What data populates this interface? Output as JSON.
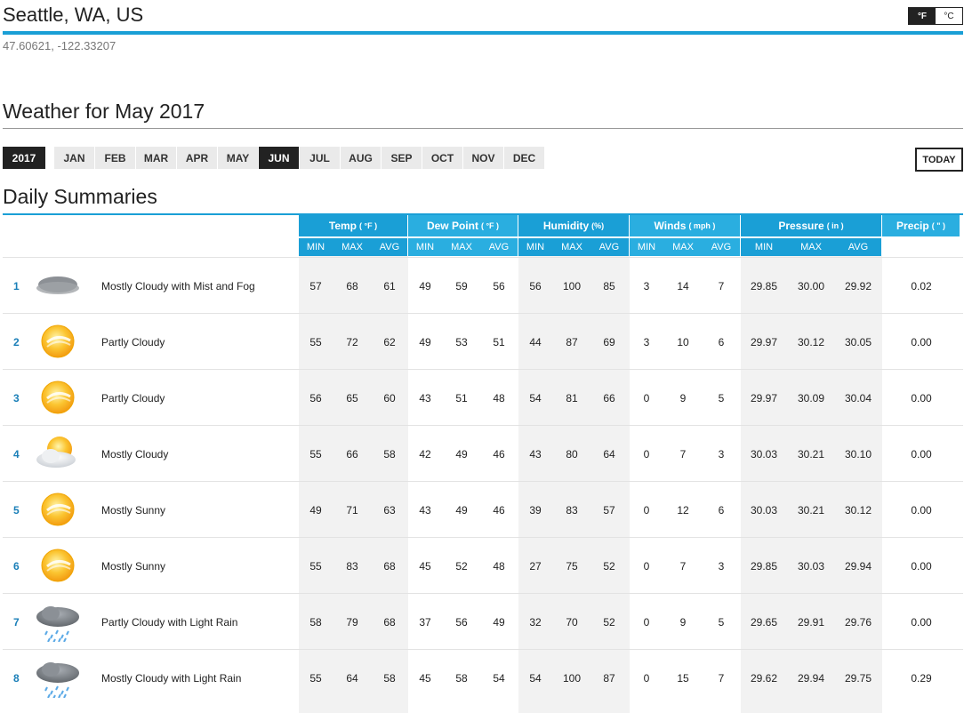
{
  "location": {
    "title": "Seattle, WA, US",
    "coords": "47.60621, -122.33207"
  },
  "units": {
    "f": "°F",
    "c": "°C"
  },
  "weather_for": "Weather for May 2017",
  "year": "2017",
  "months": [
    "JAN",
    "FEB",
    "MAR",
    "APR",
    "MAY",
    "JUN",
    "JUL",
    "AUG",
    "SEP",
    "OCT",
    "NOV",
    "DEC"
  ],
  "active_month": "JUN",
  "today_label": "TODAY",
  "daily_title": "Daily Summaries",
  "groups": [
    {
      "label": "Temp",
      "unit": "( °F )"
    },
    {
      "label": "Dew Point",
      "unit": "( °F )"
    },
    {
      "label": "Humidity",
      "unit": "(%)"
    },
    {
      "label": "Winds",
      "unit": "( mph )"
    },
    {
      "label": "Pressure",
      "unit": "( in )"
    },
    {
      "label": "Precip",
      "unit": "( \" )"
    }
  ],
  "subheaders": [
    "MIN",
    "MAX",
    "AVG"
  ],
  "colors": {
    "accent": "#1a9fd6",
    "dark": "#222222",
    "band": "#f2f2f2",
    "day_link": "#1a7fb8"
  },
  "rows": [
    {
      "day": "1",
      "icon": "fog-icon",
      "cond": "Mostly Cloudy with Mist and Fog",
      "v": [
        "57",
        "68",
        "61",
        "49",
        "59",
        "56",
        "56",
        "100",
        "85",
        "3",
        "14",
        "7",
        "29.85",
        "30.00",
        "29.92",
        "0.02"
      ]
    },
    {
      "day": "2",
      "icon": "partly-cloudy-icon",
      "cond": "Partly Cloudy",
      "v": [
        "55",
        "72",
        "62",
        "49",
        "53",
        "51",
        "44",
        "87",
        "69",
        "3",
        "10",
        "6",
        "29.97",
        "30.12",
        "30.05",
        "0.00"
      ]
    },
    {
      "day": "3",
      "icon": "partly-cloudy-icon",
      "cond": "Partly Cloudy",
      "v": [
        "56",
        "65",
        "60",
        "43",
        "51",
        "48",
        "54",
        "81",
        "66",
        "0",
        "9",
        "5",
        "29.97",
        "30.09",
        "30.04",
        "0.00"
      ]
    },
    {
      "day": "4",
      "icon": "mostly-cloudy-icon",
      "cond": "Mostly Cloudy",
      "v": [
        "55",
        "66",
        "58",
        "42",
        "49",
        "46",
        "43",
        "80",
        "64",
        "0",
        "7",
        "3",
        "30.03",
        "30.21",
        "30.10",
        "0.00"
      ]
    },
    {
      "day": "5",
      "icon": "mostly-sunny-icon",
      "cond": "Mostly Sunny",
      "v": [
        "49",
        "71",
        "63",
        "43",
        "49",
        "46",
        "39",
        "83",
        "57",
        "0",
        "12",
        "6",
        "30.03",
        "30.21",
        "30.12",
        "0.00"
      ]
    },
    {
      "day": "6",
      "icon": "mostly-sunny-icon",
      "cond": "Mostly Sunny",
      "v": [
        "55",
        "83",
        "68",
        "45",
        "52",
        "48",
        "27",
        "75",
        "52",
        "0",
        "7",
        "3",
        "29.85",
        "30.03",
        "29.94",
        "0.00"
      ]
    },
    {
      "day": "7",
      "icon": "light-rain-icon",
      "cond": "Partly Cloudy with Light Rain",
      "v": [
        "58",
        "79",
        "68",
        "37",
        "56",
        "49",
        "32",
        "70",
        "52",
        "0",
        "9",
        "5",
        "29.65",
        "29.91",
        "29.76",
        "0.00"
      ]
    },
    {
      "day": "8",
      "icon": "light-rain-icon",
      "cond": "Mostly Cloudy with Light Rain",
      "v": [
        "55",
        "64",
        "58",
        "45",
        "58",
        "54",
        "54",
        "100",
        "87",
        "0",
        "15",
        "7",
        "29.62",
        "29.94",
        "29.75",
        "0.29"
      ]
    }
  ]
}
